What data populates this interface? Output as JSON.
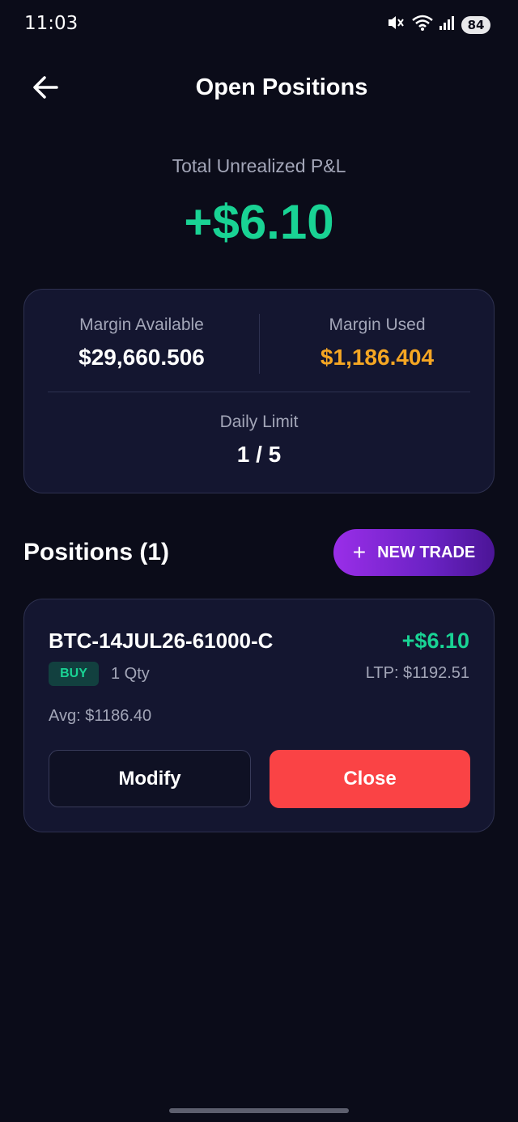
{
  "status_bar": {
    "time": "11:03",
    "battery": "84",
    "icons": [
      "mute-icon",
      "wifi-icon",
      "signal-icon",
      "battery-icon"
    ]
  },
  "header": {
    "title": "Open Positions",
    "back_icon": "arrow-left-icon"
  },
  "summary": {
    "pnl_label": "Total Unrealized P&L",
    "pnl_value": "+$6.10",
    "margin_available_label": "Margin Available",
    "margin_available_value": "$29,660.506",
    "margin_used_label": "Margin Used",
    "margin_used_value": "$1,186.404",
    "daily_limit_label": "Daily Limit",
    "daily_limit_value": "1 / 5"
  },
  "positions": {
    "title": "Positions (1)",
    "new_trade_label": "NEW TRADE",
    "new_trade_icon": "plus-icon",
    "items": [
      {
        "symbol": "BTC-14JUL26-61000-C",
        "pnl": "+$6.10",
        "side": "BUY",
        "qty": "1 Qty",
        "ltp": "LTP: $1192.51",
        "avg": "Avg: $1186.40",
        "modify_label": "Modify",
        "close_label": "Close"
      }
    ]
  },
  "colors": {
    "background": "#0b0c19",
    "card": "#141630",
    "profit": "#19d394",
    "margin_used": "#f5a623",
    "close": "#fa4345",
    "accent_purple": "#8a2be2"
  }
}
